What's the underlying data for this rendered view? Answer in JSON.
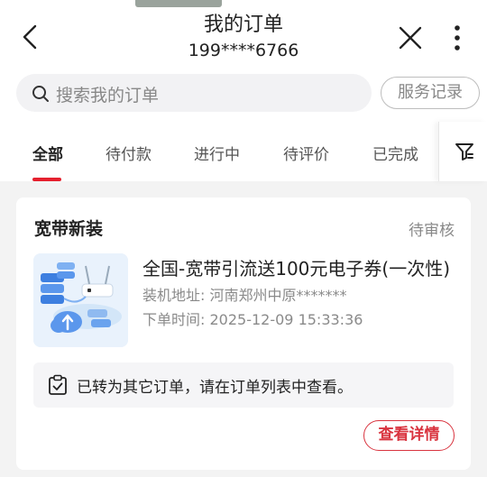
{
  "header": {
    "title": "我的订单",
    "phone": "199****6766"
  },
  "search": {
    "placeholder": "搜索我的订单",
    "service_label": "服务记录"
  },
  "tabs": [
    {
      "label": "全部",
      "active": true
    },
    {
      "label": "待付款",
      "active": false
    },
    {
      "label": "进行中",
      "active": false
    },
    {
      "label": "待评价",
      "active": false
    },
    {
      "label": "已完成",
      "active": false
    }
  ],
  "colors": {
    "accent": "#e5202e",
    "detail_button": "#d9343f"
  },
  "order": {
    "type": "宽带新装",
    "status": "待审核",
    "product_name": "全国-宽带引流送100元电子券(一次性)",
    "address_label": "装机地址:",
    "address_value": "河南郑州中原*******",
    "time_label": "下单时间:",
    "time_value": "2025-12-09 15:33:36",
    "notice": "已转为其它订单，请在订单列表中查看。",
    "detail_button": "查看详情"
  },
  "icons": {
    "back": "chevron-left-icon",
    "close": "close-icon",
    "more": "more-vertical-icon",
    "search": "search-icon",
    "filter": "filter-icon",
    "notice": "clipboard-check-icon"
  }
}
